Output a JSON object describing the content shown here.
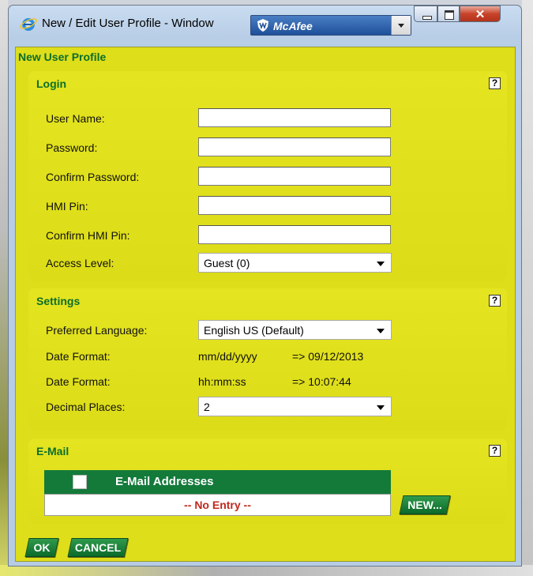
{
  "window": {
    "title": "New / Edit User Profile - Window",
    "mcafee_label": "McAfee"
  },
  "page_title": "New User Profile",
  "login": {
    "title": "Login",
    "help": "?",
    "fields": [
      {
        "label": "User Name:",
        "value": ""
      },
      {
        "label": "Password:",
        "value": ""
      },
      {
        "label": "Confirm Password:",
        "value": ""
      },
      {
        "label": "HMI Pin:",
        "value": ""
      },
      {
        "label": "Confirm HMI Pin:",
        "value": ""
      }
    ],
    "access_level_label": "Access Level:",
    "access_level_value": "Guest (0)"
  },
  "settings": {
    "title": "Settings",
    "help": "?",
    "language_label": "Preferred Language:",
    "language_value": "English US (Default)",
    "date_format_label": "Date Format:",
    "date_format_value": "mm/dd/yyyy",
    "date_example": "=> 09/12/2013",
    "time_format_label": "Date Format:",
    "time_format_value": "hh:mm:ss",
    "time_example": "=> 10:07:44",
    "decimal_label": "Decimal Places:",
    "decimal_value": "2"
  },
  "email": {
    "title": "E-Mail",
    "help": "?",
    "column_header": "E-Mail Addresses",
    "empty_text": "-- No Entry --",
    "new_button": "NEW..."
  },
  "footer": {
    "ok": "OK",
    "cancel": "CANCEL"
  }
}
